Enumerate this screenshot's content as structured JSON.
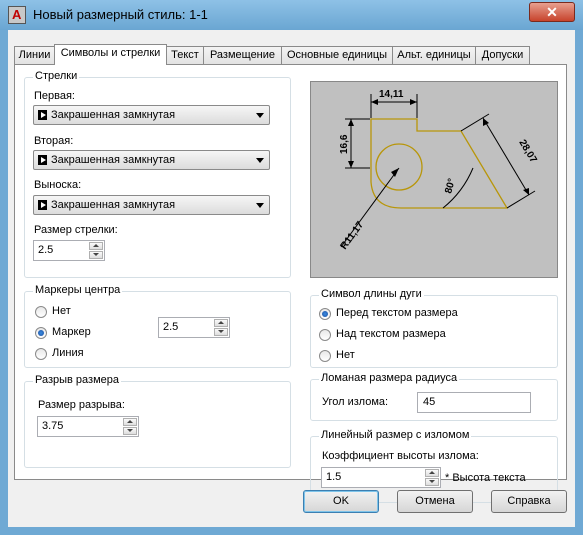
{
  "window": {
    "title": "Новый размерный стиль: 1-1",
    "close_glyph": "✕",
    "app_icon_letter": "A"
  },
  "tabs": [
    "Линии",
    "Символы и стрелки",
    "Текст",
    "Размещение",
    "Основные единицы",
    "Альт. единицы",
    "Допуски"
  ],
  "arrows": {
    "title": "Стрелки",
    "first_label": "Первая:",
    "first_value": "Закрашенная замкнутая",
    "second_label": "Вторая:",
    "second_value": "Закрашенная замкнутая",
    "leader_label": "Выноска:",
    "leader_value": "Закрашенная замкнутая",
    "size_label": "Размер стрелки:",
    "size_value": "2.5"
  },
  "center_marks": {
    "title": "Маркеры центра",
    "options": [
      "Нет",
      "Маркер",
      "Линия"
    ],
    "selected": "Маркер",
    "size_value": "2.5"
  },
  "dim_break": {
    "title": "Разрыв размера",
    "size_label": "Размер разрыва:",
    "size_value": "3.75"
  },
  "preview": {
    "dim_top": "14,11",
    "dim_left": "16,6",
    "dim_diag": "28,07",
    "angle": "80°",
    "radius": "R11,17"
  },
  "arc_length": {
    "title": "Символ длины дуги",
    "options": [
      "Перед текстом размера",
      "Над текстом размера",
      "Нет"
    ],
    "selected": "Перед текстом размера"
  },
  "radius_jog": {
    "title": "Ломаная размера радиуса",
    "angle_label": "Угол излома:",
    "angle_value": "45"
  },
  "linear_jog": {
    "title": "Линейный размер с изломом",
    "factor_label": "Коэффициент высоты излома:",
    "factor_value": "1.5",
    "factor_suffix": "* Высота текста"
  },
  "buttons": {
    "ok": "OK",
    "cancel": "Отмена",
    "help": "Справка"
  },
  "colors": {
    "titlebar": "#6fa9d4",
    "preview_bg": "#c0c0c0",
    "preview_outline": "#b8960a",
    "close": "#c7432c"
  }
}
